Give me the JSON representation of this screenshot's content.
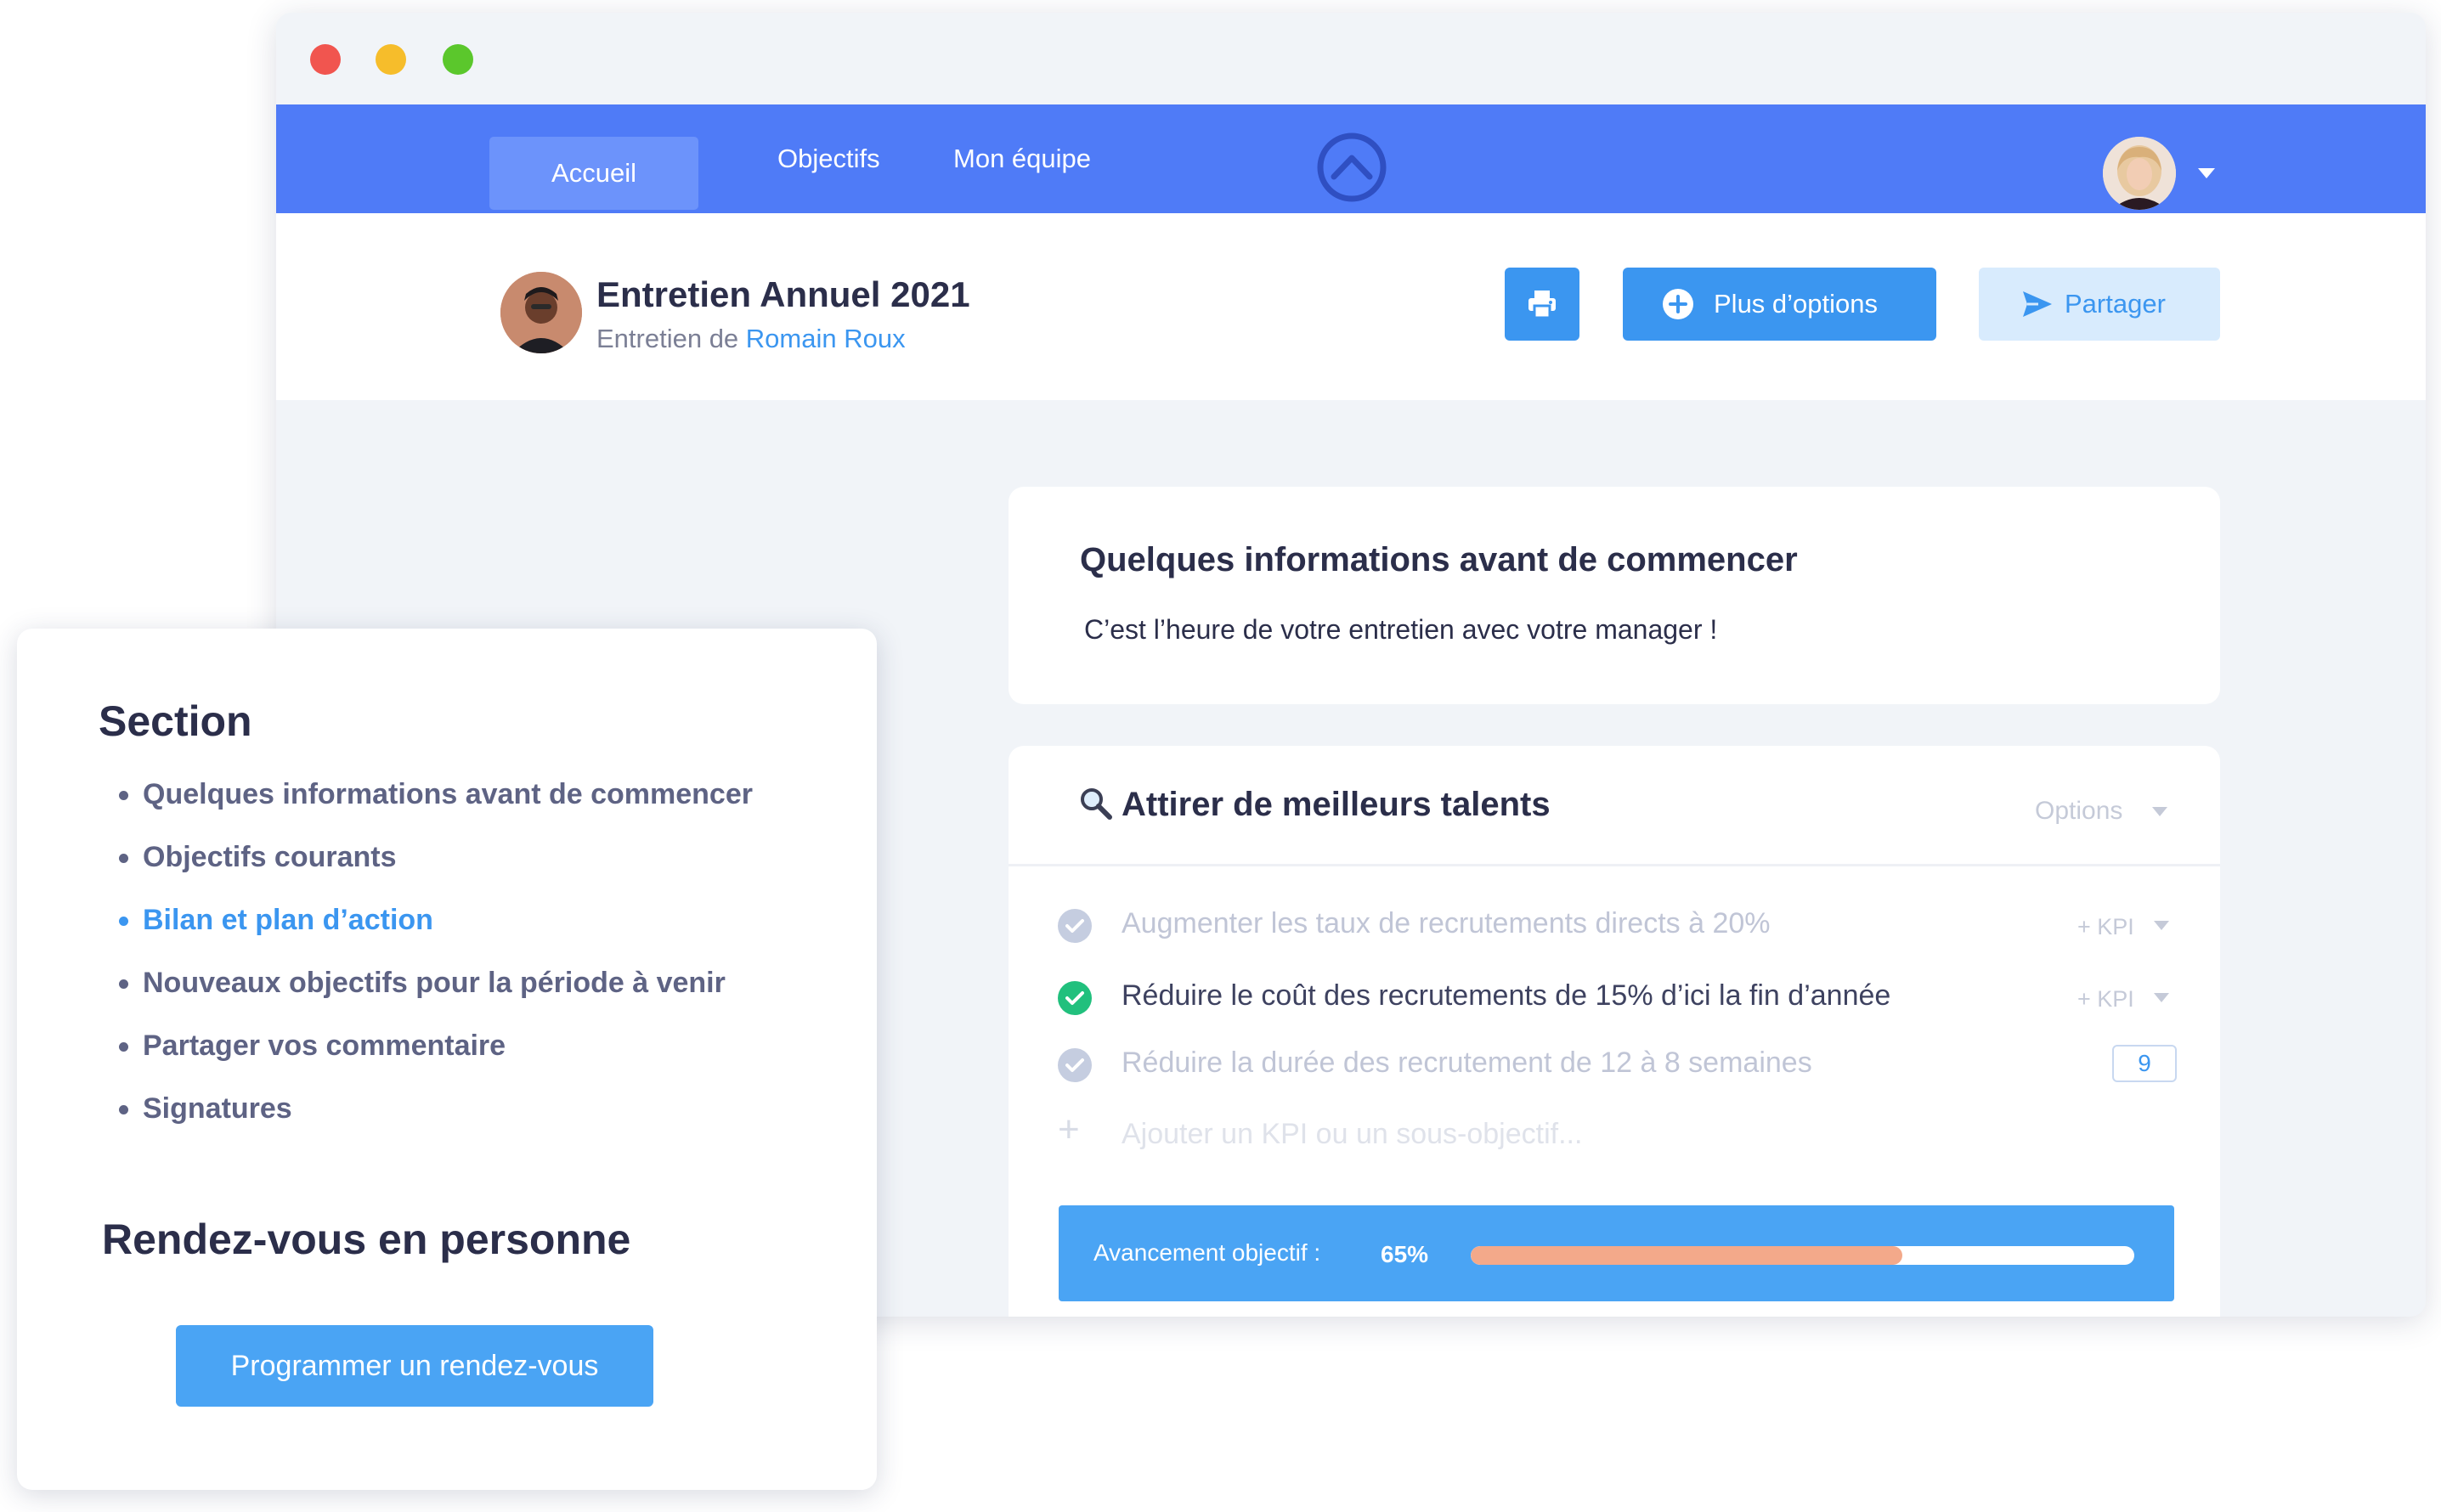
{
  "window": {
    "controls": [
      "close",
      "minimize",
      "maximize"
    ],
    "colors": {
      "close": "#f1554f",
      "minimize": "#f6bd2b",
      "maximize": "#5bc72c"
    }
  },
  "nav": {
    "tabs": [
      {
        "label": "Accueil",
        "active": true
      },
      {
        "label": "Objectifs",
        "active": false
      },
      {
        "label": "Mon équipe",
        "active": false
      }
    ],
    "logo_icon": "chevron-up-circle-icon",
    "avatar_icon": "user-avatar",
    "menu_icon": "caret-down-icon",
    "color": "#4f7bf7"
  },
  "header": {
    "title": "Entretien Annuel 2021",
    "subtitle_prefix": "Entretien de ",
    "subtitle_name": "Romain Roux",
    "print_icon": "printer-icon",
    "more_label": "Plus d’options",
    "more_icon": "plus-circle-icon",
    "share_label": "Partager",
    "share_icon": "send-icon"
  },
  "info_card": {
    "title": "Quelques informations avant de commencer",
    "text": "C’est l’heure de votre entretien avec votre manager !"
  },
  "objective_card": {
    "icon": "magnifier-icon",
    "title": "Attirer de meilleurs talents",
    "options_label": "Options",
    "kpis": [
      {
        "text": "Augmenter les taux de recrutements directs à 20%",
        "done": false,
        "tag": "+ KPI"
      },
      {
        "text": "Réduire le coût  des recrutements de 15% d’ici la fin d’année",
        "done": true,
        "tag": "+ KPI"
      },
      {
        "text": "Réduire la durée des recrutement de 12 à 8 semaines",
        "done": false,
        "value": "9"
      }
    ],
    "add_placeholder": "Ajouter un KPI ou un sous-objectif...",
    "progress_label": "Avancement objectif :",
    "progress_value": "65%",
    "progress_fraction": 0.65,
    "progress_color": "#f3a98a"
  },
  "side_card": {
    "title": "Section",
    "items": [
      {
        "label": "Quelques informations avant de commencer",
        "active": false
      },
      {
        "label": "Objectifs courants",
        "active": false
      },
      {
        "label": "Bilan et plan d’action",
        "active": true
      },
      {
        "label": "Nouveaux objectifs pour la période à venir",
        "active": false
      },
      {
        "label": "Partager vos commentaire",
        "active": false
      },
      {
        "label": "Signatures",
        "active": false
      }
    ],
    "subtitle": "Rendez-vous en personne",
    "button_label": "Programmer un rendez-vous"
  }
}
